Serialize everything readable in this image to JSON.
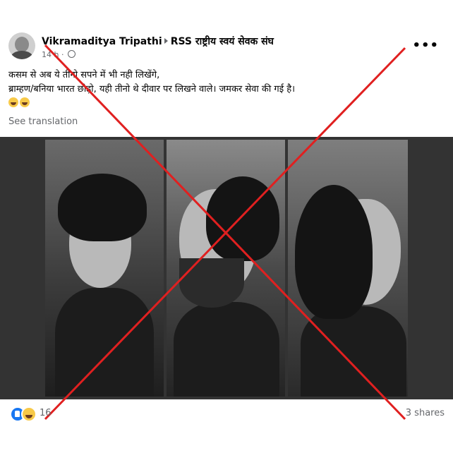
{
  "post": {
    "author": "Vikramaditya Tripathi",
    "group": "RSS राष्ट्रीय स्वयं सेवक संघ",
    "time": "14 h",
    "more_label": "•••",
    "text_line1": "कसम से अब ये तीनो सपने में भी नही लिखेंगे,",
    "text_line2": "ब्राम्हण/बनिया भारत छोड़ो, यही तीनो थे दीवार पर लिखने वाले। जमकर सेवा की गई है।",
    "see_translation": "See translation",
    "reaction_count": "16",
    "shares": "3 shares"
  },
  "colors": {
    "x_mark": "#e02020",
    "like_blue": "#1877f2",
    "meta_gray": "#65676b"
  },
  "icons": [
    "avatar",
    "globe-icon",
    "more-icon",
    "laugh-emoji-icon",
    "like-icon",
    "haha-icon"
  ]
}
